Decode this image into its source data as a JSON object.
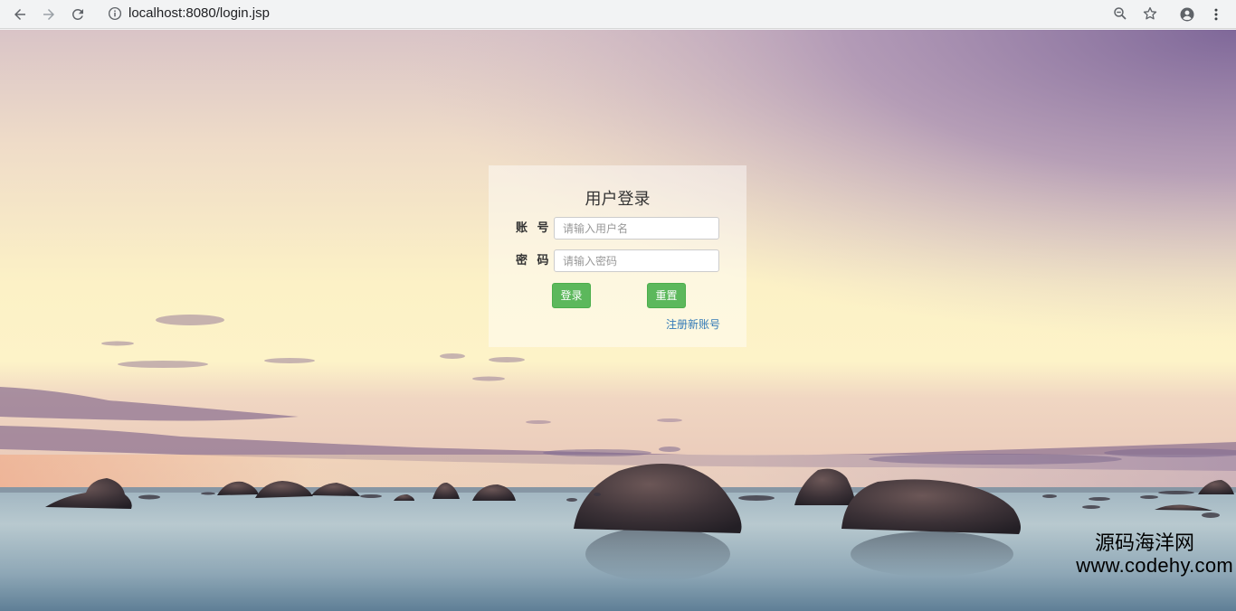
{
  "browser": {
    "url": "localhost:8080/login.jsp",
    "icons": [
      "back-arrow-icon",
      "forward-arrow-icon",
      "reload-icon",
      "info-icon",
      "zoom-icon",
      "bookmark-star-icon",
      "account-icon",
      "menu-dots-icon"
    ]
  },
  "login": {
    "title": "用户登录",
    "username_label": "账 号",
    "username_placeholder": "请输入用户名",
    "username_value": "",
    "password_label": "密 码",
    "password_placeholder": "请输入密码",
    "password_value": "",
    "login_button": "登录",
    "reset_button": "重置",
    "register_link": "注册新账号"
  },
  "watermark": {
    "line1": "源码海洋网",
    "line2": "www.codehy.com"
  },
  "colors": {
    "button_green": "#5cb85c",
    "link_blue": "#337ab7"
  }
}
